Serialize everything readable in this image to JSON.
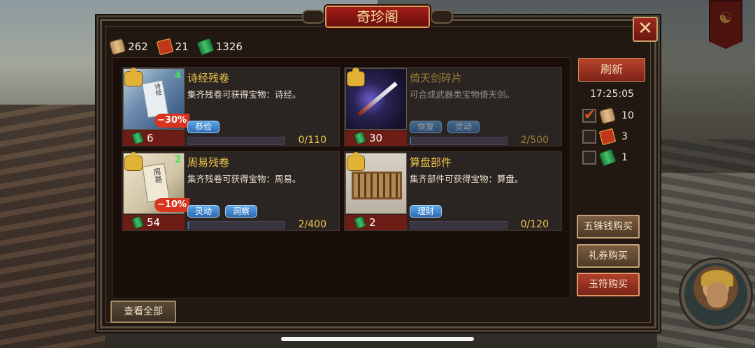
{
  "window": {
    "title": "奇珍阁",
    "close_symbol": "✕"
  },
  "currency": [
    {
      "icon": "scroll-icon",
      "value": "262"
    },
    {
      "icon": "ticket-icon",
      "value": "21"
    },
    {
      "icon": "jade-icon",
      "value": "1326"
    }
  ],
  "items": [
    {
      "name": "诗经残卷",
      "desc": "集齐残卷可获得宝物：诗经。",
      "count": "4",
      "discount": "−30%",
      "price": "6",
      "tags": [
        "恭俭"
      ],
      "progress": "0/110",
      "progress_fraction": 0
    },
    {
      "name": "倚天剑碎片",
      "desc": "可合成武器类宝物倚天剑。",
      "count": "",
      "discount": "",
      "price": "30",
      "tags": [
        "恢复",
        "灵动"
      ],
      "progress": "2/500",
      "progress_fraction": 0.004
    },
    {
      "name": "周易残卷",
      "desc": "集齐残卷可获得宝物：周易。",
      "count": "2",
      "discount": "−10%",
      "price": "54",
      "tags": [
        "灵动",
        "洞察"
      ],
      "progress": "2/400",
      "progress_fraction": 0.005
    },
    {
      "name": "算盘部件",
      "desc": "集齐部件可获得宝物：算盘。",
      "count": "",
      "discount": "",
      "price": "2",
      "tags": [
        "理财"
      ],
      "progress": "0/120",
      "progress_fraction": 0
    }
  ],
  "side": {
    "refresh_label": "刷新",
    "timer": "17:25:05",
    "options": [
      {
        "icon": "scroll-icon",
        "value": "10",
        "checked": true
      },
      {
        "icon": "ticket-icon",
        "value": "3",
        "checked": false
      },
      {
        "icon": "jade-icon",
        "value": "1",
        "checked": false
      }
    ],
    "buy_wuzhu_label": "五铢钱购买",
    "buy_voucher_label": "礼券购买",
    "buy_jade_label": "玉符购买"
  },
  "view_all_label": "查看全部",
  "thumb_labels": {
    "book1": "诗经",
    "book2": "周易"
  },
  "colors": {
    "accent_gold": "#f2c94a",
    "tag_blue": "#3e86d0",
    "discount_red": "#d8341f"
  }
}
